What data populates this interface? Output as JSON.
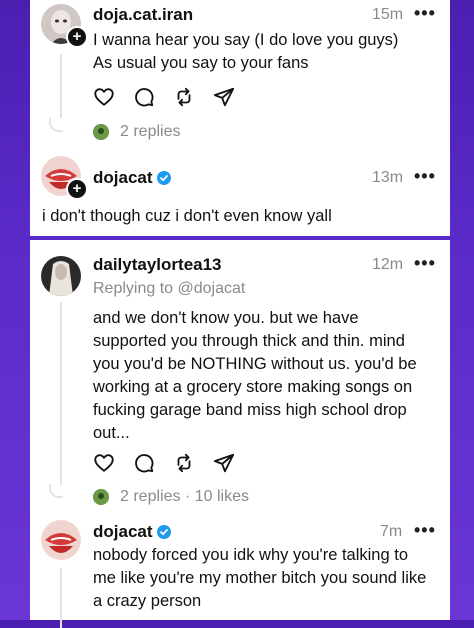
{
  "posts": [
    {
      "username": "doja.cat.iran",
      "time": "15m",
      "more": "•••",
      "lines": [
        "I wanna hear you say (I do love you guys)",
        "As usual you say to your fans"
      ],
      "replies_text": "2 replies"
    },
    {
      "username": "dojacat",
      "verified": true,
      "time": "13m",
      "more": "•••",
      "lines": [
        "i don't though cuz i don't even know yall"
      ]
    },
    {
      "username": "dailytaylortea13",
      "time": "12m",
      "more": "•••",
      "replying_to": "Replying to @dojacat",
      "lines": [
        "and we don't know you. but we have",
        "supported you through thick and thin. mind",
        "you you'd be NOTHING without us. you'd be",
        "working at a grocery store making songs on",
        "fucking garage band miss high school drop",
        "out..."
      ],
      "replies_text": "2 replies",
      "likes_text": "10 likes",
      "meta_sep": "·"
    },
    {
      "username": "dojacat",
      "verified": true,
      "time": "7m",
      "more": "•••",
      "lines": [
        "nobody forced you idk why you're talking to",
        "me like you're my mother bitch you sound like",
        "a crazy person"
      ]
    }
  ],
  "colors": {
    "verified": "#1d9bf0",
    "background": "#5a2bc9"
  }
}
